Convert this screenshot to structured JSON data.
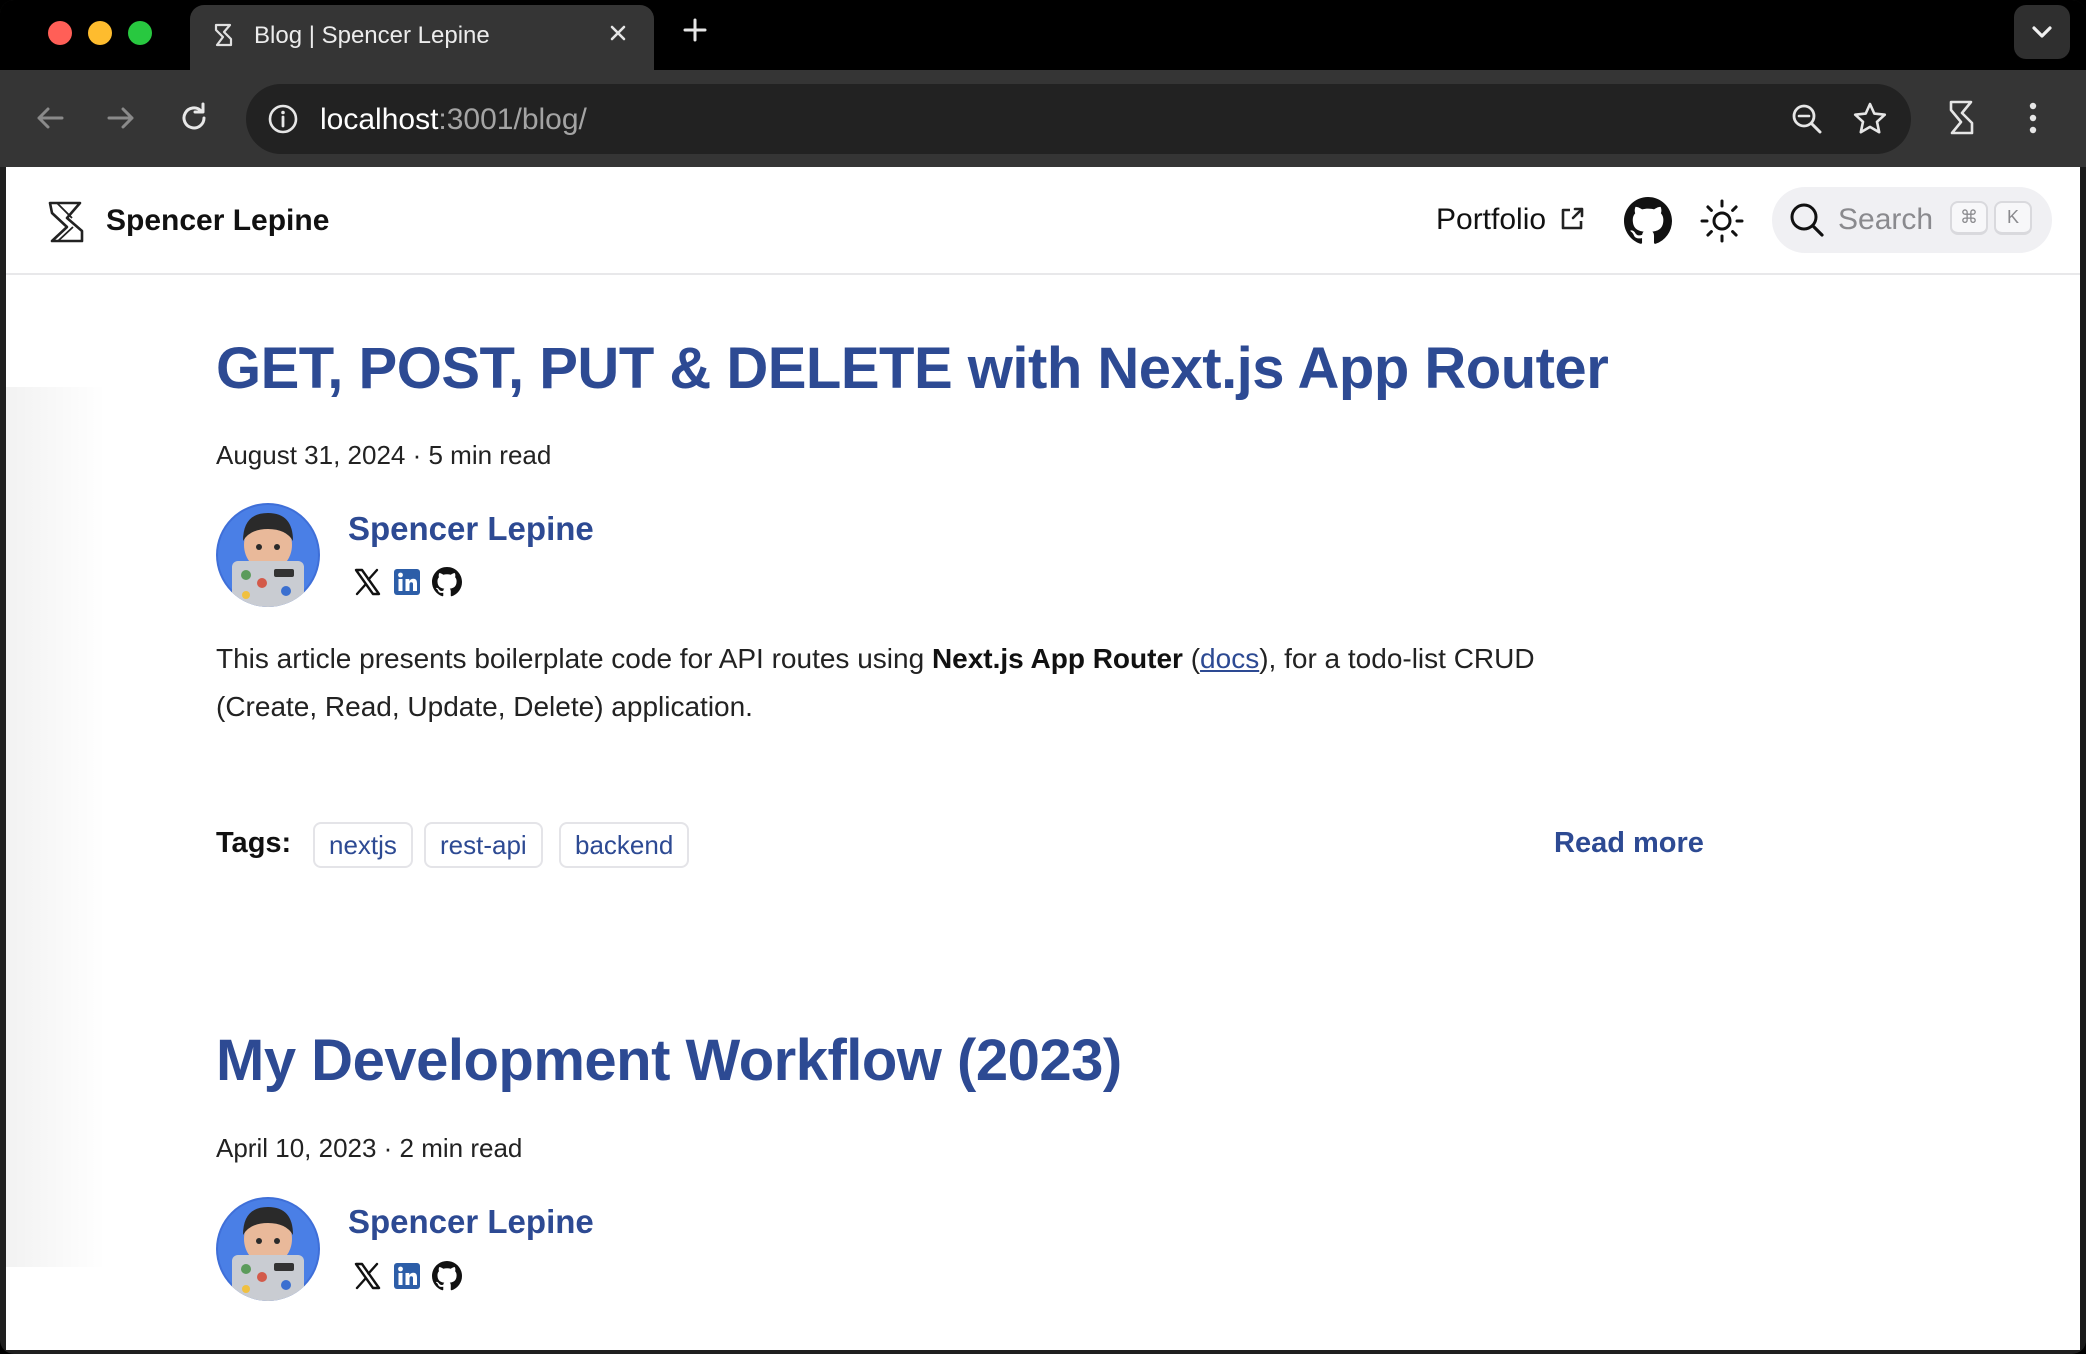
{
  "browser": {
    "tab_title": "Blog | Spencer Lepine",
    "url_host": "localhost",
    "url_path": ":3001/blog/"
  },
  "header": {
    "site_name": "Spencer Lepine",
    "portfolio_label": "Portfolio",
    "search_placeholder": "Search",
    "shortcut_cmd": "⌘",
    "shortcut_key": "K"
  },
  "posts": [
    {
      "title": "GET, POST, PUT & DELETE with Next.js App Router",
      "meta": "August 31, 2024 · 5 min read",
      "author": "Spencer Lepine",
      "excerpt_before": "This article presents boilerplate code for API routes using ",
      "excerpt_bold": "Next.js App Router",
      "excerpt_open": " (",
      "excerpt_link": "docs",
      "excerpt_after": "), for a todo-list CRUD (Create, Read, Update, Delete) application.",
      "tags_label": "Tags:",
      "tags": [
        "nextjs",
        "rest-api",
        "backend"
      ],
      "read_more": "Read more"
    },
    {
      "title": "My Development Workflow (2023)",
      "meta": "April 10, 2023 · 2 min read",
      "author": "Spencer Lepine"
    }
  ],
  "colors": {
    "accent": "#2d4a93",
    "chrome_dark": "#353535",
    "traffic_red": "#ff5f57",
    "traffic_yellow": "#febc2e",
    "traffic_green": "#28c840"
  }
}
